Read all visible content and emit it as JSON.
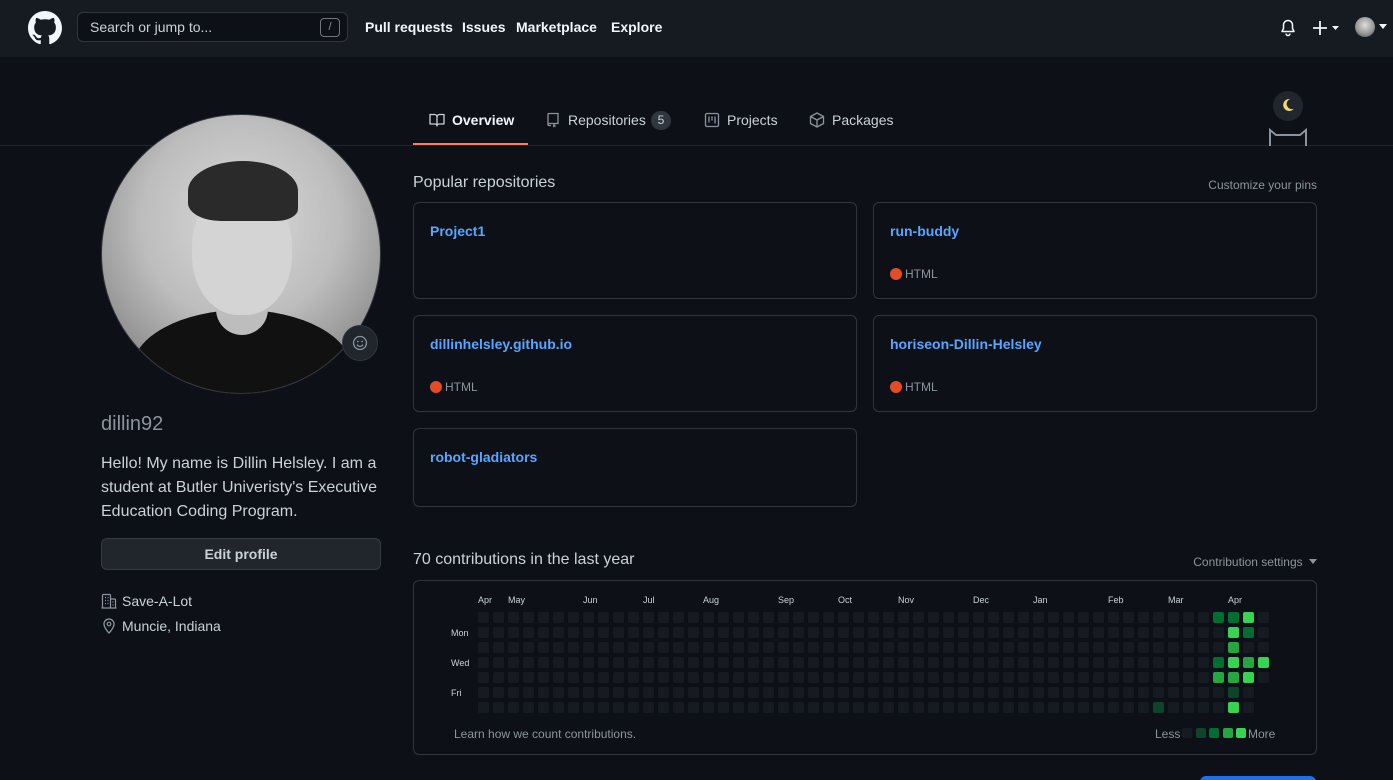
{
  "header": {
    "search_placeholder": "Search or jump to...",
    "search_shortcut": "/",
    "nav": [
      "Pull requests",
      "Issues",
      "Marketplace",
      "Explore"
    ]
  },
  "tabs": [
    {
      "label": "Overview",
      "icon": "book-icon",
      "selected": true
    },
    {
      "label": "Repositories",
      "icon": "repo-icon",
      "count": "5"
    },
    {
      "label": "Projects",
      "icon": "project-icon"
    },
    {
      "label": "Packages",
      "icon": "package-icon"
    }
  ],
  "profile": {
    "username": "dillin92",
    "bio": "Hello! My name is Dillin Helsley. I am a student at Butler Univeristy's Executive Education Coding Program.",
    "edit_label": "Edit profile",
    "company": "Save-A-Lot",
    "location": "Muncie, Indiana"
  },
  "popular": {
    "title": "Popular repositories",
    "customize": "Customize your pins",
    "repos": [
      {
        "name": "Project1",
        "language": ""
      },
      {
        "name": "run-buddy",
        "language": "HTML"
      },
      {
        "name": "dillinhelsley.github.io",
        "language": "HTML"
      },
      {
        "name": "horiseon-Dillin-Helsley",
        "language": "HTML"
      },
      {
        "name": "robot-gladiators",
        "language": ""
      }
    ]
  },
  "contributions": {
    "title": "70 contributions in the last year",
    "settings": "Contribution settings",
    "months": [
      "Apr",
      "May",
      "Jun",
      "Jul",
      "Aug",
      "Sep",
      "Oct",
      "Nov",
      "Dec",
      "Jan",
      "Feb",
      "Mar",
      "Apr"
    ],
    "weekdays": [
      "Mon",
      "Wed",
      "Fri"
    ],
    "learn": "Learn how we count contributions.",
    "less": "Less",
    "more": "More",
    "colors": [
      "#161b22",
      "#0e4429",
      "#006d32",
      "#26a641",
      "#39d353"
    ]
  }
}
